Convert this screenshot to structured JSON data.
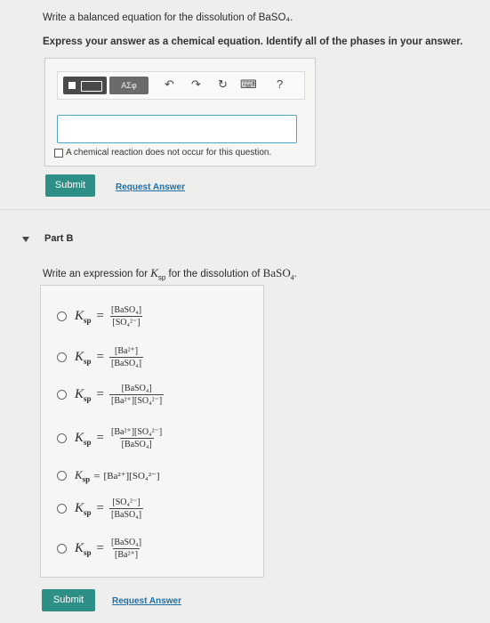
{
  "part_a": {
    "question": "Write a balanced equation for the dissolution of BaSO₄.",
    "instruction": "Express your answer as a chemical equation. Identify all of the phases in your answer.",
    "toolbar": {
      "symbol_label": "AΣφ",
      "undo_icon": "↶",
      "redo_icon": "↷",
      "reset_icon": "↻",
      "keyboard_icon": "⌨",
      "help_icon": "?"
    },
    "answer_value": "",
    "no_reaction_label": "A chemical reaction does not occur for this question.",
    "submit_label": "Submit",
    "request_label": "Request Answer"
  },
  "part_b": {
    "title": "Part B",
    "question": "Write an expression for Ksp for the dissolution of BaSO₄.",
    "options": [
      {
        "lhs": "K",
        "sub": "sp",
        "num": "[BaSO₄]",
        "den": "[SO₄²⁻]"
      },
      {
        "lhs": "K",
        "sub": "sp",
        "num": "[Ba²⁺]",
        "den": "[BaSO₄]"
      },
      {
        "lhs": "K",
        "sub": "sp",
        "num": "[BaSO₄]",
        "den": "[Ba²⁺][SO₄²⁻]"
      },
      {
        "lhs": "K",
        "sub": "sp",
        "num": "[Ba²⁺][SO₄²⁻]",
        "den": "[BaSO₄]"
      },
      {
        "lhs": "K",
        "sub": "sp",
        "expr": "[Ba²⁺][SO₄²⁻]"
      },
      {
        "lhs": "K",
        "sub": "sp",
        "num": "[SO₄²⁻]",
        "den": "[BaSO₄]"
      },
      {
        "lhs": "K",
        "sub": "sp",
        "num": "[BaSO₄]",
        "den": "[Ba²⁺]"
      }
    ],
    "submit_label": "Submit",
    "request_label": "Request Answer"
  }
}
